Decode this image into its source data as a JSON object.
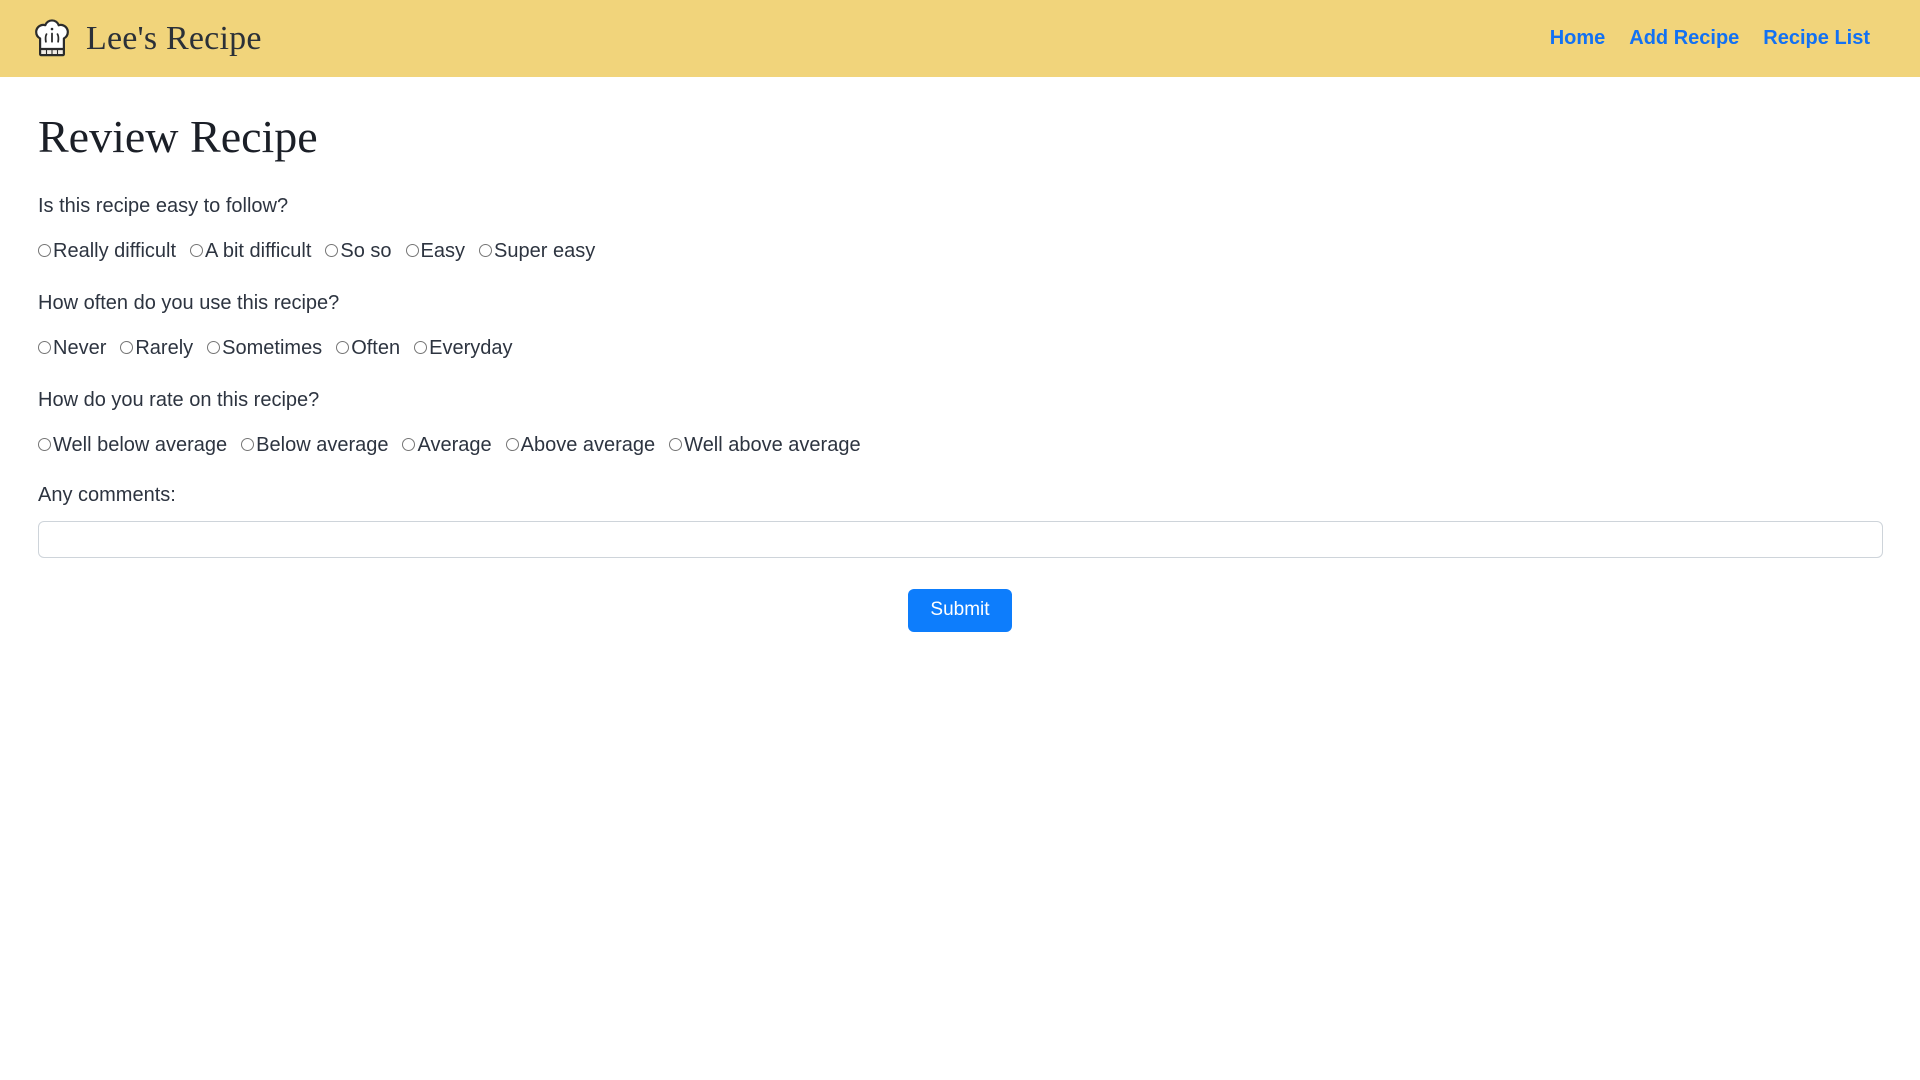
{
  "header": {
    "brand": {
      "icon": "chef-hat-icon",
      "text": "Lee's Recipe"
    },
    "nav": [
      {
        "label": "Home"
      },
      {
        "label": "Add Recipe"
      },
      {
        "label": "Recipe List"
      }
    ],
    "colors": {
      "background": "#f1d47b",
      "link": "#1271f3",
      "brand_text": "#2b3038"
    }
  },
  "main": {
    "title": "Review Recipe",
    "questions": [
      {
        "prompt": "Is this recipe easy to follow?",
        "options": [
          "Really difficult",
          "A bit difficult",
          "So so",
          "Easy",
          "Super easy"
        ]
      },
      {
        "prompt": "How often do you use this recipe?",
        "options": [
          "Never",
          "Rarely",
          "Sometimes",
          "Often",
          "Everyday"
        ]
      },
      {
        "prompt": "How do you rate on this recipe?",
        "options": [
          "Well below average",
          "Below average",
          "Average",
          "Above average",
          "Well above average"
        ]
      }
    ],
    "comments": {
      "label": "Any comments:",
      "value": "",
      "placeholder": ""
    },
    "submit": {
      "label": "Submit",
      "color": "#0d7dfc"
    }
  }
}
